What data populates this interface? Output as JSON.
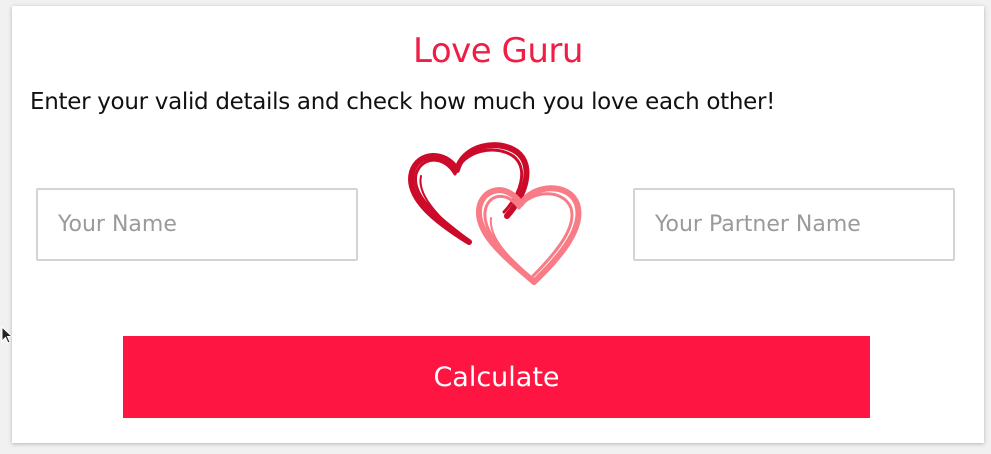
{
  "app": {
    "title": "Love Guru",
    "subtitle": "Enter your valid details and check how much you love each other!"
  },
  "form": {
    "name_placeholder": "Your Name",
    "partner_placeholder": "Your Partner Name",
    "name_value": "",
    "partner_value": "",
    "submit_label": "Calculate"
  },
  "icons": {
    "hearts": "two-interlocked-hearts-icon",
    "cursor": "mouse-pointer-icon"
  },
  "colors": {
    "accent": "#ff1541",
    "title": "#ee1e45",
    "heart_dark": "#cc0a2a",
    "heart_light": "#f87b86"
  }
}
